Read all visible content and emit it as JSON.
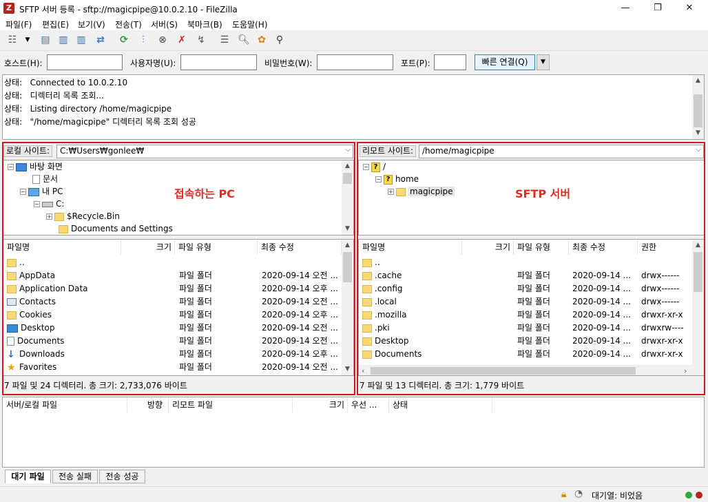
{
  "window": {
    "title": "SFTP 서버 등록 - sftp://magicpipe@10.0.2.10 - FileZilla",
    "app_icon": "Z"
  },
  "menu": [
    "파일(F)",
    "편집(E)",
    "보기(V)",
    "전송(T)",
    "서버(S)",
    "북마크(B)",
    "도움말(H)"
  ],
  "quickconnect": {
    "host_label": "호스트(H):",
    "user_label": "사용자명(U):",
    "pass_label": "비밀번호(W):",
    "port_label": "포트(P):",
    "host_value": "",
    "user_value": "",
    "pass_value": "",
    "port_value": "",
    "connect_label": "빠른 연결(Q)"
  },
  "log": [
    {
      "prefix": "상태:",
      "text": "Connected to 10.0.2.10"
    },
    {
      "prefix": "상태:",
      "text": "디렉터리 목록 조회..."
    },
    {
      "prefix": "상태:",
      "text": "Listing directory /home/magicpipe"
    },
    {
      "prefix": "상태:",
      "text": "\"/home/magicpipe\" 디렉터리 목록 조회 성공"
    }
  ],
  "local": {
    "site_label": "로컬 사이트:",
    "path": "C:₩Users₩gonlee₩",
    "tree": [
      "바탕 화면",
      "문서",
      "내 PC",
      "C:",
      "$Recycle.Bin",
      "Documents and Settings"
    ],
    "columns": [
      "파일명",
      "크기",
      "파일 유형",
      "최종 수정"
    ],
    "files": [
      {
        "name": "..",
        "type": "",
        "modified": ""
      },
      {
        "name": "AppData",
        "type": "파일 폴더",
        "modified": "2020-09-14 오전 ..."
      },
      {
        "name": "Application Data",
        "type": "파일 폴더",
        "modified": "2020-09-14 오후 ..."
      },
      {
        "name": "Contacts",
        "type": "파일 폴더",
        "modified": "2020-09-14 오전 ..."
      },
      {
        "name": "Cookies",
        "type": "파일 폴더",
        "modified": "2020-09-14 오후 ..."
      },
      {
        "name": "Desktop",
        "type": "파일 폴더",
        "modified": "2020-09-14 오전 ..."
      },
      {
        "name": "Documents",
        "type": "파일 폴더",
        "modified": "2020-09-14 오전 ..."
      },
      {
        "name": "Downloads",
        "type": "파일 폴더",
        "modified": "2020-09-14 오후 ..."
      },
      {
        "name": "Favorites",
        "type": "파일 폴더",
        "modified": "2020-09-14 오전 ..."
      }
    ],
    "summary": "7 파일 및 24 디렉터리. 총 크기: 2,733,076 바이트",
    "annotation": "접속하는 PC"
  },
  "remote": {
    "site_label": "리모트 사이트:",
    "path": "/home/magicpipe",
    "tree": [
      "/",
      "home",
      "magicpipe"
    ],
    "columns": [
      "파일명",
      "크기",
      "파일 유형",
      "최종 수정",
      "권한"
    ],
    "files": [
      {
        "name": "..",
        "type": "",
        "modified": "",
        "perm": ""
      },
      {
        "name": ".cache",
        "type": "파일 폴더",
        "modified": "2020-09-14 ...",
        "perm": "drwx------"
      },
      {
        "name": ".config",
        "type": "파일 폴더",
        "modified": "2020-09-14 ...",
        "perm": "drwx------"
      },
      {
        "name": ".local",
        "type": "파일 폴더",
        "modified": "2020-09-14 ...",
        "perm": "drwx------"
      },
      {
        "name": ".mozilla",
        "type": "파일 폴더",
        "modified": "2020-09-14 ...",
        "perm": "drwxr-xr-x"
      },
      {
        "name": ".pki",
        "type": "파일 폴더",
        "modified": "2020-09-14 ...",
        "perm": "drwxrw----"
      },
      {
        "name": "Desktop",
        "type": "파일 폴더",
        "modified": "2020-09-14 ...",
        "perm": "drwxr-xr-x"
      },
      {
        "name": "Documents",
        "type": "파일 폴더",
        "modified": "2020-09-14 ...",
        "perm": "drwxr-xr-x"
      }
    ],
    "summary": "7 파일 및 13 디렉터리. 총 크기: 1,779 바이트",
    "annotation": "SFTP 서버"
  },
  "queue": {
    "columns": [
      "서버/로컬 파일",
      "방향",
      "리모트 파일",
      "크기",
      "우선 ...",
      "상태"
    ],
    "tabs": [
      "대기 파일",
      "전송 실패",
      "전송 성공"
    ]
  },
  "statusbar": {
    "queue_text": "대기열: 비었음"
  },
  "colors": {
    "annotation_red": "#d9141b",
    "folder_yellow": "#f8d775"
  }
}
